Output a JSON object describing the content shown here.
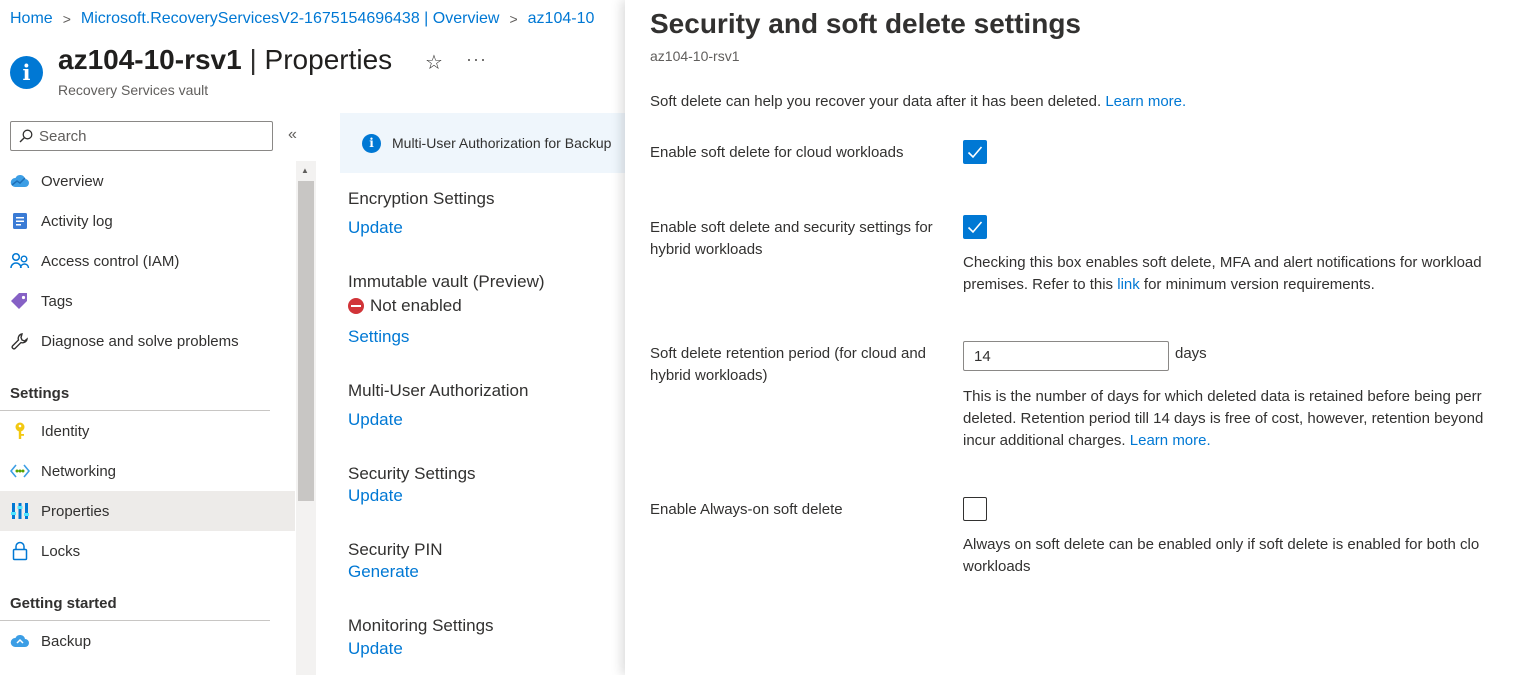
{
  "breadcrumb": {
    "items": [
      "Home",
      "Microsoft.RecoveryServicesV2-1675154696438 | Overview",
      "az104-10"
    ]
  },
  "header": {
    "icon": "info-icon",
    "title_name": "az104-10-rsv1",
    "title_sep": "|",
    "title_page": "Properties",
    "subtitle": "Recovery Services vault"
  },
  "sidebar": {
    "search_placeholder": "Search",
    "collapse_label": "«",
    "items": [
      {
        "label": "Overview",
        "icon": "cloud-icon"
      },
      {
        "label": "Activity log",
        "icon": "activity-log-icon"
      },
      {
        "label": "Access control (IAM)",
        "icon": "people-icon"
      },
      {
        "label": "Tags",
        "icon": "tag-icon"
      },
      {
        "label": "Diagnose and solve problems",
        "icon": "wrench-icon"
      }
    ],
    "section_settings": "Settings",
    "settings_items": [
      {
        "label": "Identity",
        "icon": "key-icon"
      },
      {
        "label": "Networking",
        "icon": "network-icon"
      },
      {
        "label": "Properties",
        "icon": "properties-icon",
        "active": true
      },
      {
        "label": "Locks",
        "icon": "lock-icon"
      }
    ],
    "section_getting_started": "Getting started",
    "getting_started_items": [
      {
        "label": "Backup",
        "icon": "cloud-backup-icon"
      }
    ]
  },
  "main": {
    "info_text": "Multi-User Authorization for Backup",
    "properties": [
      {
        "title": "Encryption Settings",
        "link": "Update"
      },
      {
        "title": "Immutable vault (Preview)",
        "status": "Not enabled",
        "link": "Settings"
      },
      {
        "title": "Multi-User Authorization",
        "link": "Update"
      },
      {
        "title": "Security Settings",
        "link": "Update"
      },
      {
        "title": "Security PIN",
        "link": "Generate"
      },
      {
        "title": "Monitoring Settings",
        "link": "Update"
      }
    ]
  },
  "panel": {
    "title": "Security and soft delete settings",
    "subtitle": "az104-10-rsv1",
    "intro": "Soft delete can help you recover your data after it has been deleted.",
    "intro_link": "Learn more.",
    "cloud_label": "Enable soft delete for cloud workloads",
    "cloud_checked": true,
    "hybrid_label": "Enable soft delete and security settings for hybrid workloads",
    "hybrid_checked": true,
    "hybrid_desc_line1": "Checking this box enables soft delete, MFA and alert notifications for workload",
    "hybrid_desc_line2_pre": "premises. Refer to this",
    "hybrid_desc_link": "link",
    "hybrid_desc_line2_post": "for minimum version requirements.",
    "retention_label": "Soft delete retention period (for cloud and hybrid workloads)",
    "retention_value": "14",
    "retention_unit": "days",
    "retention_desc_line1": "This is the number of days for which deleted data is retained before being perr",
    "retention_desc_line2": "deleted. Retention period till 14 days is free of cost, however, retention beyond",
    "retention_desc_line3_pre": "incur additional charges.",
    "retention_desc_link": "Learn more.",
    "always_on_label": "Enable Always-on soft delete",
    "always_on_checked": false,
    "always_on_desc_line1": "Always on soft delete can be enabled only if soft delete is enabled for both clo",
    "always_on_desc_line2": "workloads"
  },
  "colors": {
    "accent": "#0078d4",
    "error": "#d13438",
    "active_nav": "#edebe9"
  }
}
